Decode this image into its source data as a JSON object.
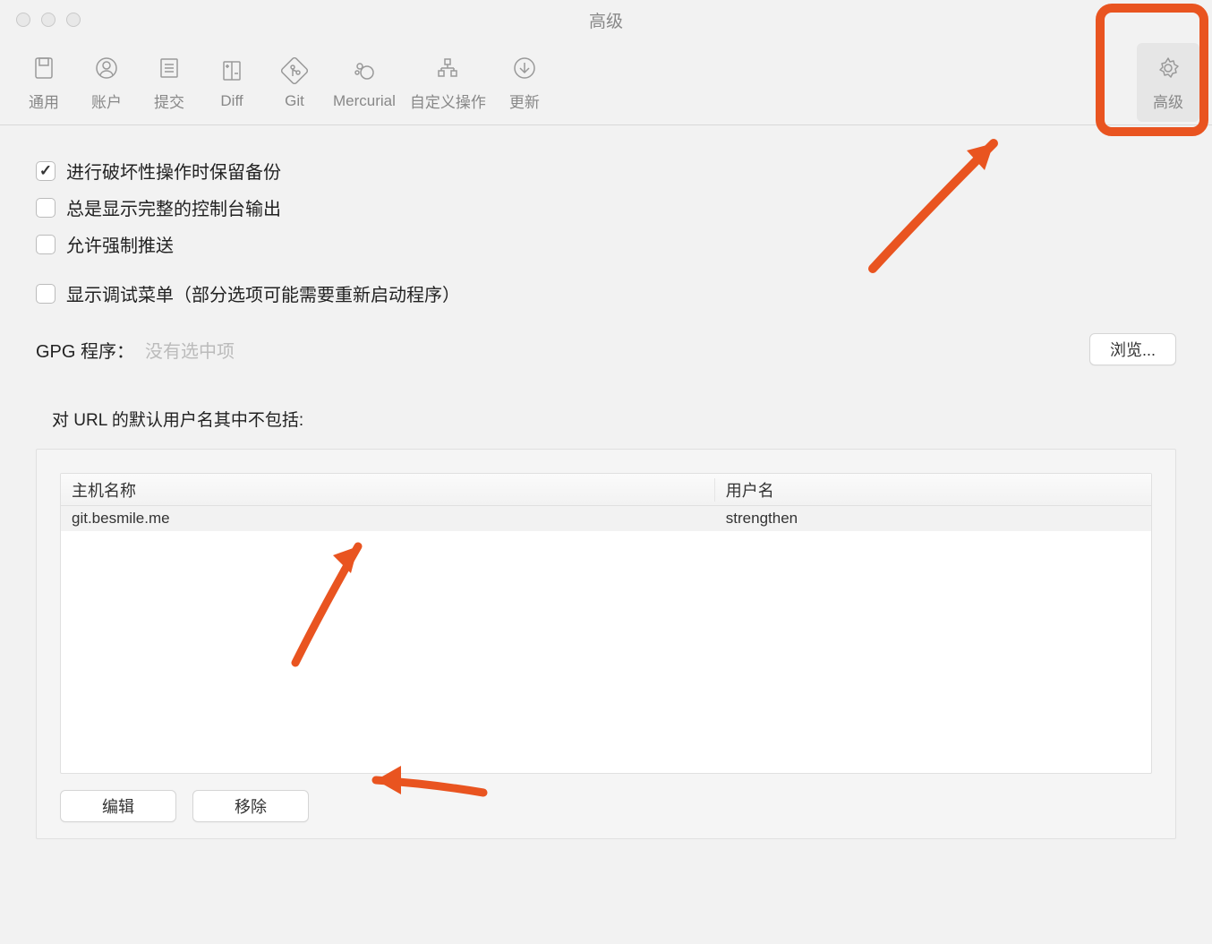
{
  "window": {
    "title": "高级"
  },
  "toolbar": {
    "items": [
      {
        "label": "通用",
        "icon": "general"
      },
      {
        "label": "账户",
        "icon": "account"
      },
      {
        "label": "提交",
        "icon": "commit"
      },
      {
        "label": "Diff",
        "icon": "diff"
      },
      {
        "label": "Git",
        "icon": "git"
      },
      {
        "label": "Mercurial",
        "icon": "mercurial"
      },
      {
        "label": "自定义操作",
        "icon": "custom"
      },
      {
        "label": "更新",
        "icon": "update"
      }
    ],
    "advanced": {
      "label": "高级",
      "icon": "gear"
    }
  },
  "checkboxes": {
    "backup_destructive": {
      "label": "进行破坏性操作时保留备份",
      "checked": true
    },
    "full_console": {
      "label": "总是显示完整的控制台输出",
      "checked": false
    },
    "force_push": {
      "label": "允许强制推送",
      "checked": false
    },
    "debug_menu": {
      "label": "显示调试菜单（部分选项可能需要重新启动程序）",
      "checked": false
    }
  },
  "gpg": {
    "label": "GPG 程序：",
    "value": "没有选中项",
    "browse": "浏览..."
  },
  "hosts_section": {
    "label": "对 URL 的默认用户名其中不包括:",
    "columns": {
      "host": "主机名称",
      "user": "用户名"
    },
    "rows": [
      {
        "host": "git.besmile.me",
        "user": "strengthen"
      }
    ],
    "buttons": {
      "edit": "编辑",
      "remove": "移除"
    }
  }
}
